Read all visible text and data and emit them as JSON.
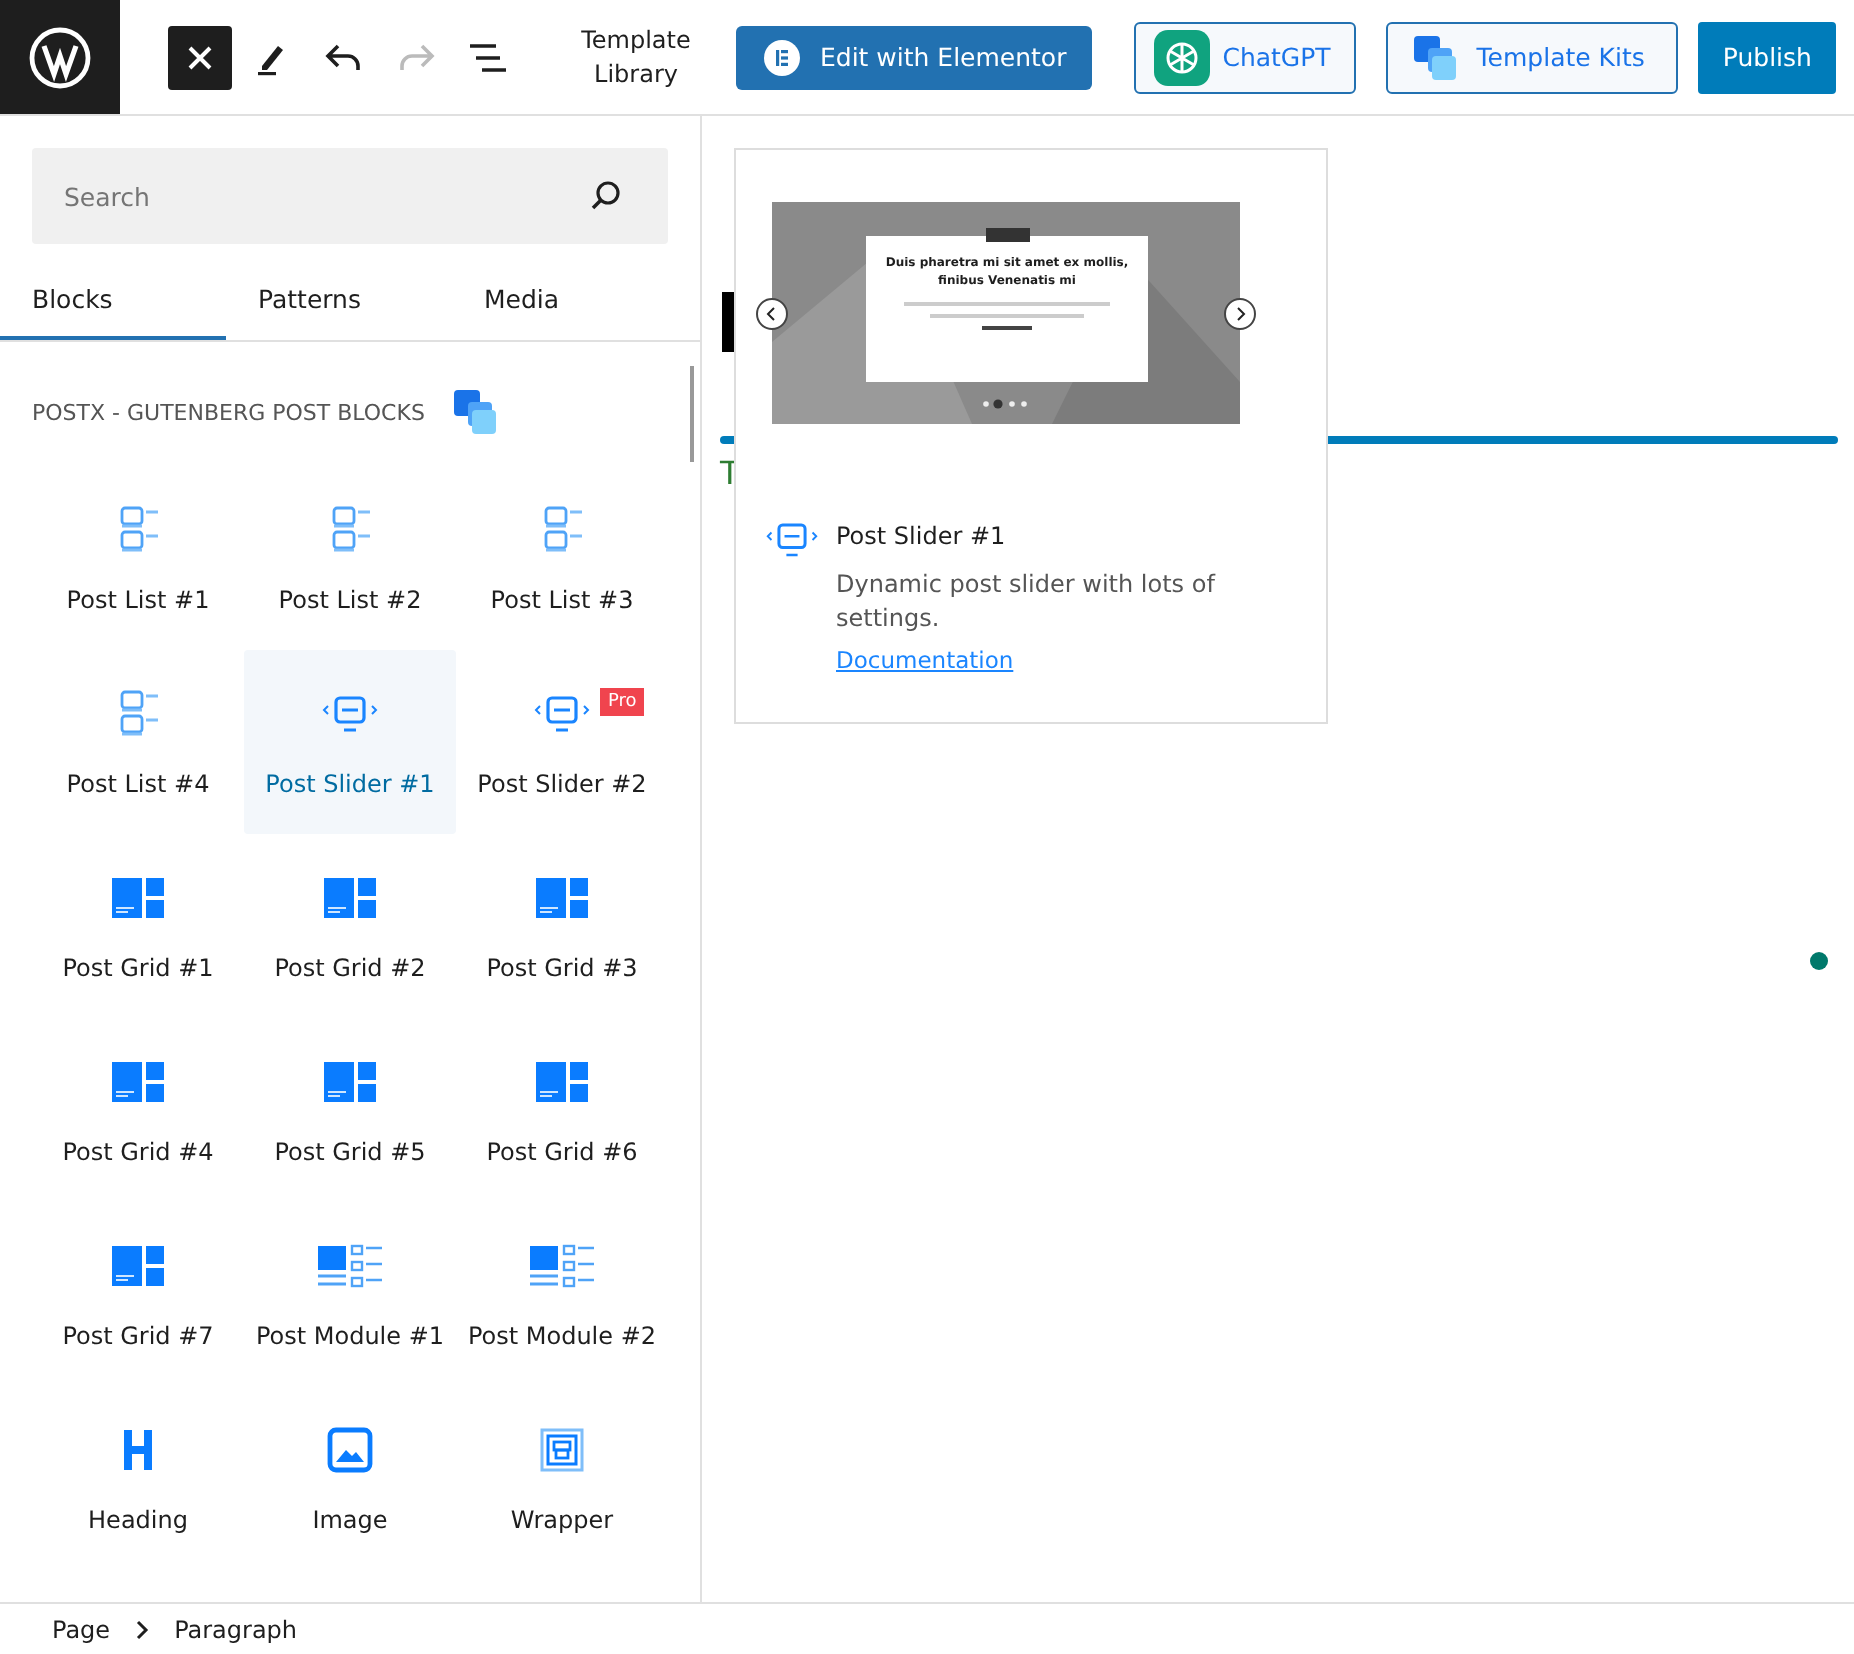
{
  "toolbar": {
    "tools": [
      {
        "kind": "close",
        "pressed": true,
        "disabled": false
      },
      {
        "kind": "edit",
        "pressed": false,
        "disabled": false
      },
      {
        "kind": "undo",
        "pressed": false,
        "disabled": false
      },
      {
        "kind": "redo",
        "pressed": false,
        "disabled": true
      },
      {
        "kind": "outline",
        "pressed": false,
        "disabled": false
      }
    ],
    "template_library": "Template Library",
    "elementor": "Edit with Elementor",
    "chatgpt": "ChatGPT",
    "template_kits": "Template Kits",
    "publish": "Publish"
  },
  "sidebar": {
    "search": {
      "placeholder": "Search"
    },
    "tabs": [
      {
        "label": "Blocks",
        "selected": true
      },
      {
        "label": "Patterns",
        "selected": false
      },
      {
        "label": "Media",
        "selected": false
      }
    ],
    "category": "POSTX - GUTENBERG POST BLOCKS",
    "blocks": [
      {
        "label": "Post List #1",
        "selected": false
      },
      {
        "label": "Post List #2",
        "selected": false
      },
      {
        "label": "Post List #3",
        "selected": false
      },
      {
        "label": "Post List #4",
        "selected": false
      },
      {
        "label": "Post Slider #1",
        "selected": true
      },
      {
        "label": "Post Slider #2",
        "selected": false,
        "badge": "Pro"
      },
      {
        "label": "Post Grid #1",
        "selected": false
      },
      {
        "label": "Post Grid #2",
        "selected": false
      },
      {
        "label": "Post Grid #3",
        "selected": false
      },
      {
        "label": "Post Grid #4",
        "selected": false
      },
      {
        "label": "Post Grid #5",
        "selected": false
      },
      {
        "label": "Post Grid #6",
        "selected": false
      },
      {
        "label": "Post Grid #7",
        "selected": false
      },
      {
        "label": "Post Module #1",
        "selected": false
      },
      {
        "label": "Post Module #2",
        "selected": false
      },
      {
        "label": "Heading",
        "selected": false
      },
      {
        "label": "Image",
        "selected": false
      },
      {
        "label": "Wrapper",
        "selected": false
      }
    ]
  },
  "canvas": {
    "text_fragment": "T"
  },
  "preview": {
    "slide_title": "Duis pharetra mi sit amet ex mollis, finibus Venenatis mi",
    "title": "Post Slider #1",
    "description": "Dynamic post slider with lots of settings.",
    "link": "Documentation"
  },
  "breadcrumb": [
    "Page",
    "Paragraph"
  ]
}
